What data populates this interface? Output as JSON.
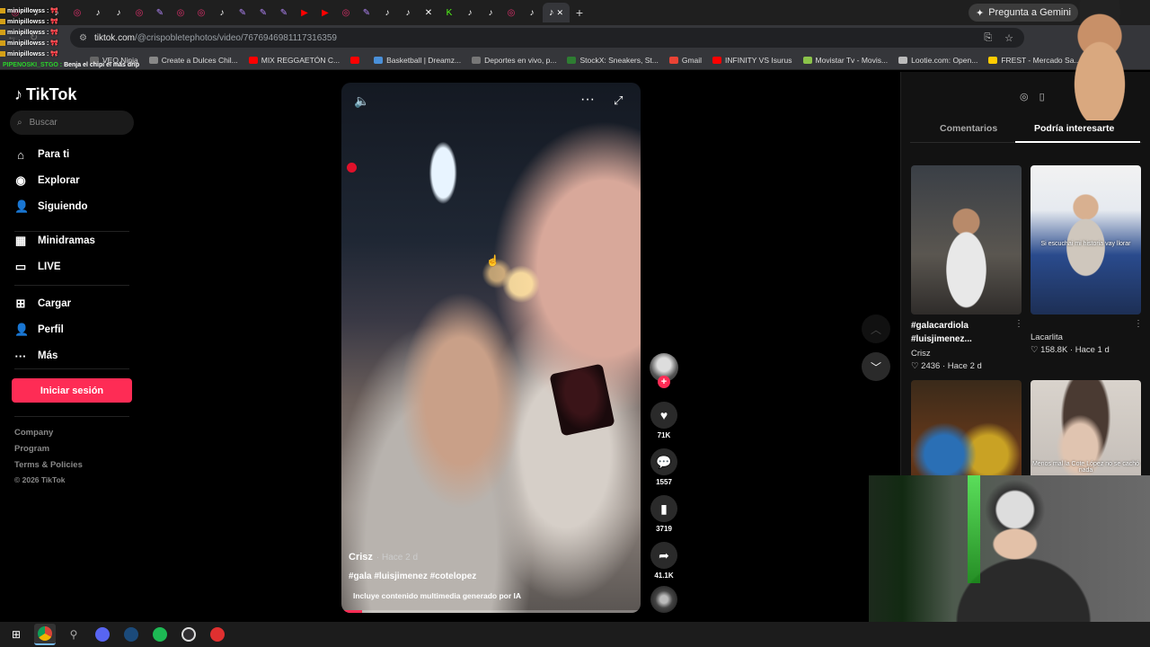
{
  "browser": {
    "tabs": [
      {
        "icon": "instagram-icon",
        "color": "#e1306c"
      },
      {
        "icon": "tiktok-icon",
        "color": "#ffffff"
      },
      {
        "icon": "tiktok-icon",
        "color": "#ffffff"
      },
      {
        "icon": "instagram-icon",
        "color": "#e1306c"
      },
      {
        "icon": "tiktok-icon",
        "color": "#ffffff"
      },
      {
        "icon": "tiktok-icon",
        "color": "#ffffff"
      },
      {
        "icon": "instagram-icon",
        "color": "#e1306c"
      },
      {
        "icon": "pen-icon",
        "color": "#b084f5"
      },
      {
        "icon": "instagram-icon",
        "color": "#e1306c"
      },
      {
        "icon": "instagram-icon",
        "color": "#e1306c"
      },
      {
        "icon": "tiktok-icon",
        "color": "#ffffff"
      },
      {
        "icon": "pen-icon",
        "color": "#b084f5"
      },
      {
        "icon": "pen-icon",
        "color": "#b084f5"
      },
      {
        "icon": "pen-icon",
        "color": "#b084f5"
      },
      {
        "icon": "youtube-icon",
        "color": "#ff0000"
      },
      {
        "icon": "youtube-icon",
        "color": "#ff0000"
      },
      {
        "icon": "instagram-icon",
        "color": "#e1306c"
      },
      {
        "icon": "pen-icon",
        "color": "#b084f5"
      },
      {
        "icon": "tiktok-icon",
        "color": "#ffffff"
      },
      {
        "icon": "tiktok-icon",
        "color": "#ffffff"
      },
      {
        "icon": "x-icon",
        "color": "#ffffff"
      },
      {
        "icon": "kick-icon",
        "color": "#53fc18"
      },
      {
        "icon": "tiktok-icon",
        "color": "#ffffff"
      },
      {
        "icon": "tiktok-icon",
        "color": "#ffffff"
      },
      {
        "icon": "instagram-icon",
        "color": "#e1306c"
      },
      {
        "icon": "tiktok-icon",
        "color": "#ffffff"
      }
    ],
    "gemini_label": "Pregunta a Gemini",
    "url_host": "tiktok.com",
    "url_path": "/@crispobletephotos/video/7676946981117316359",
    "bookmarks": [
      {
        "label": "VEO.Ninja",
        "color": "#666666"
      },
      {
        "label": "Create a Dulces Chil...",
        "color": "#888888"
      },
      {
        "label": "MIX REGGAETÓN C...",
        "color": "#ff0000"
      },
      {
        "label": "",
        "color": "#ff0000"
      },
      {
        "label": "Basketball | Dreamz...",
        "color": "#4a90d9"
      },
      {
        "label": "Deportes en vivo, p...",
        "color": "#777777"
      },
      {
        "label": "StockX: Sneakers, St...",
        "color": "#2e7d32"
      },
      {
        "label": "Gmail",
        "color": "#ea4335"
      },
      {
        "label": "INFINITY VS Isurus",
        "color": "#ff0000"
      },
      {
        "label": "Movistar Tv - Movis...",
        "color": "#8bc34a"
      },
      {
        "label": "Lootie.com: Open...",
        "color": "#bbbbbb"
      },
      {
        "label": "FREST - Mercado Sa...",
        "color": "#ffcc00"
      }
    ]
  },
  "chat": {
    "lines": [
      "minipillowss :",
      "minipillowss :",
      "minipillowss :",
      "minipillowss :",
      "minipillowss :"
    ],
    "last_user": "PIPENOSKI_STGO :",
    "last_msg": "Benja el chipi el más drip"
  },
  "sidebar": {
    "logo": "TikTok",
    "search_placeholder": "Buscar",
    "items": [
      {
        "label": "Para ti",
        "icon": "home-icon"
      },
      {
        "label": "Explorar",
        "icon": "compass-icon"
      },
      {
        "label": "Siguiendo",
        "icon": "following-icon"
      },
      {
        "label": "Minidramas",
        "icon": "film-icon"
      },
      {
        "label": "LIVE",
        "icon": "live-icon"
      },
      {
        "label": "Cargar",
        "icon": "upload-icon"
      },
      {
        "label": "Perfil",
        "icon": "profile-icon"
      },
      {
        "label": "Más",
        "icon": "more-icon"
      }
    ],
    "login_label": "Iniciar sesión",
    "footer": [
      "Company",
      "Program",
      "Terms & Policies",
      "© 2026 TikTok"
    ]
  },
  "video": {
    "author": "Crisz",
    "time": "· Hace 2 d",
    "description": "#gala #luisjimenez #cotelopez",
    "ai_notice": "Incluye contenido multimedia generado por IA",
    "progress": 0.07,
    "likes": "71K",
    "comments": "1557",
    "saves": "3719",
    "shares": "41.1K"
  },
  "panel": {
    "tab_comments": "Comentarios",
    "tab_foryou": "Podría interesarte",
    "cards": [
      {
        "title": "#galacardiola #luisjimenez...",
        "author": "Crisz",
        "stats": "2436 · Hace 2 d",
        "heart": false
      },
      {
        "title": "",
        "author": "Lacarlita",
        "stats": "158.8K · Hace 1 d",
        "heart": true,
        "overlay": "Si escuchai mi historia vay llorar"
      },
      {
        "title": "",
        "author": "",
        "stats": "",
        "heart": false
      },
      {
        "title": "",
        "author": "",
        "stats": "",
        "heart": false,
        "overlay": "Menos mal la Cote López no se cachó nada"
      }
    ]
  },
  "colors": {
    "accent": "#fe2c55",
    "background": "#000000",
    "panel": "#121212"
  }
}
